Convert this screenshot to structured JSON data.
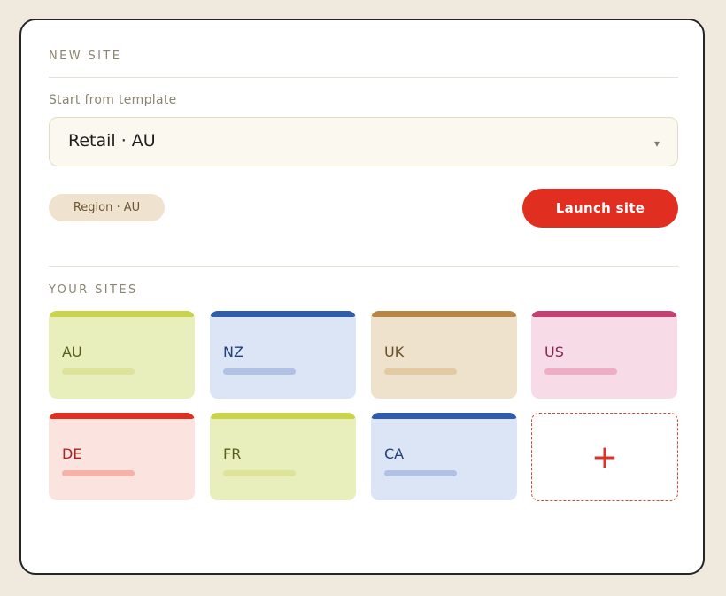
{
  "new_site": {
    "heading": "NEW SITE",
    "template_label": "Start from template",
    "template_value": "Retail · AU",
    "region_badge": "Region · AU",
    "launch_label": "Launch site",
    "chevron": "▾"
  },
  "your_sites": {
    "heading": "YOUR SITES",
    "tiles": [
      {
        "code": "AU",
        "accent": "#c9d44a",
        "bg": "#e9eebd",
        "text": "#58601c",
        "line": "#dde49a"
      },
      {
        "code": "NZ",
        "accent": "#2f5cab",
        "bg": "#dce5f5",
        "text": "#21407a",
        "line": "#b0c1e4"
      },
      {
        "code": "UK",
        "accent": "#b88745",
        "bg": "#efe2cd",
        "text": "#6b5126",
        "line": "#e2cba3"
      },
      {
        "code": "US",
        "accent": "#c73e73",
        "bg": "#f7dbe6",
        "text": "#862950",
        "line": "#eeadc5"
      },
      {
        "code": "DE",
        "accent": "#e02f21",
        "bg": "#fbe4df",
        "text": "#a5281e",
        "line": "#f4b2a8"
      },
      {
        "code": "FR",
        "accent": "#c9d44a",
        "bg": "#e9eebd",
        "text": "#58601c",
        "line": "#dde49a"
      },
      {
        "code": "CA",
        "accent": "#2f5cab",
        "bg": "#dce5f5",
        "text": "#21407a",
        "line": "#b0c1e4"
      }
    ],
    "add_label": "+"
  }
}
